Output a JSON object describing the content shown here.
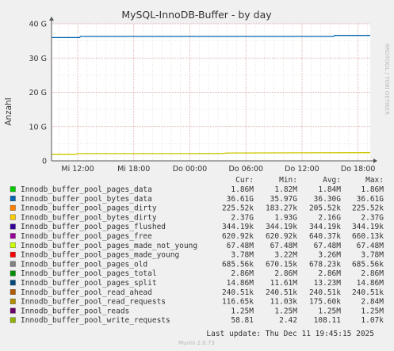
{
  "chart_data": {
    "type": "line",
    "title": "MySQL-InnoDB-Buffer - by day",
    "ylabel": "Anzahl",
    "watermark": "RRDTOOL / TOBI OETIKER",
    "ylim": [
      0,
      40000000000
    ],
    "y_ticks": [
      {
        "value": 0,
        "label": "0"
      },
      {
        "value": 10000000000,
        "label": "10 G"
      },
      {
        "value": 20000000000,
        "label": "20 G"
      },
      {
        "value": 30000000000,
        "label": "30 G"
      },
      {
        "value": 40000000000,
        "label": "40 G"
      }
    ],
    "x_hours_range": [
      -2.8,
      31.3
    ],
    "x_ticks": [
      {
        "hour": 0,
        "label": "Mi 12:00"
      },
      {
        "hour": 6,
        "label": "Mi 18:00"
      },
      {
        "hour": 12,
        "label": "Do 00:00"
      },
      {
        "hour": 18,
        "label": "Do 06:00"
      },
      {
        "hour": 24,
        "label": "Do 12:00"
      },
      {
        "hour": 30,
        "label": "Do 18:00"
      }
    ],
    "grid": true,
    "series": [
      {
        "name": "Innodb_buffer_pool_bytes_data",
        "color": "#0066b3",
        "points": [
          [
            -2.8,
            35970000000
          ],
          [
            0.2,
            35970000000
          ],
          [
            0.3,
            36300000000
          ],
          [
            12.0,
            36300000000
          ],
          [
            27.4,
            36300000000
          ],
          [
            27.5,
            36610000000
          ],
          [
            31.3,
            36610000000
          ]
        ]
      },
      {
        "name": "Innodb_buffer_pool_bytes_dirty",
        "color": "#ccc800",
        "points": [
          [
            -2.8,
            1930000000
          ],
          [
            -0.2,
            1930000000
          ],
          [
            0.0,
            2100000000
          ],
          [
            12.0,
            2100000000
          ],
          [
            15.5,
            2150000000
          ],
          [
            16.0,
            2300000000
          ],
          [
            31.3,
            2370000000
          ]
        ]
      }
    ],
    "legend": {
      "headers": [
        "Cur:",
        "Min:",
        "Avg:",
        "Max:"
      ],
      "rows": [
        {
          "color": "#00cc00",
          "name": "Innodb_buffer_pool_pages_data",
          "cur": "1.86M",
          "min": "1.82M",
          "avg": "1.84M",
          "max": "1.86M"
        },
        {
          "color": "#0066b3",
          "name": "Innodb_buffer_pool_bytes_data",
          "cur": "36.61G",
          "min": "35.97G",
          "avg": "36.30G",
          "max": "36.61G"
        },
        {
          "color": "#ff8000",
          "name": "Innodb_buffer_pool_pages_dirty",
          "cur": "225.52k",
          "min": "183.27k",
          "avg": "205.52k",
          "max": "225.52k"
        },
        {
          "color": "#ffcc00",
          "name": "Innodb_buffer_pool_bytes_dirty",
          "cur": "2.37G",
          "min": "1.93G",
          "avg": "2.16G",
          "max": "2.37G"
        },
        {
          "color": "#330099",
          "name": "Innodb_buffer_pool_pages_flushed",
          "cur": "344.19k",
          "min": "344.19k",
          "avg": "344.19k",
          "max": "344.19k"
        },
        {
          "color": "#990099",
          "name": "Innodb_buffer_pool_pages_free",
          "cur": "620.92k",
          "min": "620.92k",
          "avg": "640.37k",
          "max": "660.13k"
        },
        {
          "color": "#ccff00",
          "name": "Innodb_buffer_pool_pages_made_not_young",
          "cur": "67.48M",
          "min": "67.48M",
          "avg": "67.48M",
          "max": "67.48M"
        },
        {
          "color": "#ff0000",
          "name": "Innodb_buffer_pool_pages_made_young",
          "cur": "3.78M",
          "min": "3.22M",
          "avg": "3.26M",
          "max": "3.78M"
        },
        {
          "color": "#808080",
          "name": "Innodb_buffer_pool_pages_old",
          "cur": "685.56k",
          "min": "670.15k",
          "avg": "678.23k",
          "max": "685.56k"
        },
        {
          "color": "#008f00",
          "name": "Innodb_buffer_pool_pages_total",
          "cur": "2.86M",
          "min": "2.86M",
          "avg": "2.86M",
          "max": "2.86M"
        },
        {
          "color": "#00487d",
          "name": "Innodb_buffer_pool_pages_split",
          "cur": "14.86M",
          "min": "11.61M",
          "avg": "13.23M",
          "max": "14.86M"
        },
        {
          "color": "#b35a00",
          "name": "Innodb_buffer_pool_read_ahead",
          "cur": "240.51k",
          "min": "240.51k",
          "avg": "240.51k",
          "max": "240.51k"
        },
        {
          "color": "#b38f00",
          "name": "Innodb_buffer_pool_read_requests",
          "cur": "116.65k",
          "min": "11.03k",
          "avg": "175.60k",
          "max": "2.84M"
        },
        {
          "color": "#6b006b",
          "name": "Innodb_buffer_pool_reads",
          "cur": "1.25M",
          "min": "1.25M",
          "avg": "1.25M",
          "max": "1.25M"
        },
        {
          "color": "#8fb300",
          "name": "Innodb_buffer_pool_write_requests",
          "cur": "58.81",
          "min": "2.42",
          "avg": "108.11",
          "max": "1.07k"
        }
      ]
    },
    "last_update": "Last update:  Thu Dec 11 19:45:15 2025",
    "footer": "Munin 2.0.73"
  }
}
